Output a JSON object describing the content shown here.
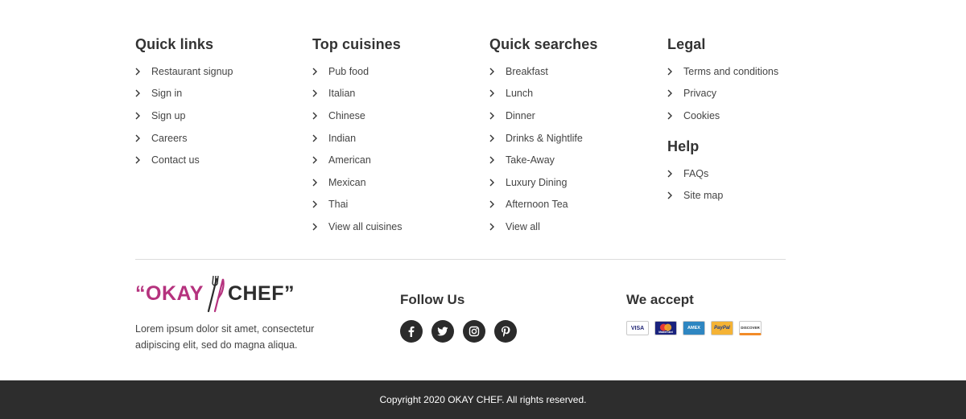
{
  "columns": {
    "quick_links": {
      "title": "Quick links",
      "items": [
        "Restaurant signup",
        "Sign in",
        "Sign up",
        "Careers",
        "Contact us"
      ]
    },
    "top_cuisines": {
      "title": "Top cuisines",
      "items": [
        "Pub food",
        "Italian",
        "Chinese",
        "Indian",
        "American",
        "Mexican",
        "Thai",
        "View all cuisines"
      ]
    },
    "quick_searches": {
      "title": "Quick searches",
      "items": [
        "Breakfast",
        "Lunch",
        "Dinner",
        "Drinks & Nightlife",
        "Take-Away",
        "Luxury Dining",
        "Afternoon Tea",
        "View all"
      ]
    },
    "legal": {
      "title": "Legal",
      "items": [
        "Terms and conditions",
        "Privacy",
        "Cookies"
      ]
    },
    "help": {
      "title": "Help",
      "items": [
        "FAQs",
        "Site map"
      ]
    }
  },
  "brand": {
    "logo_left": "“OKAY",
    "logo_right": "CHEF”",
    "description": "Lorem ipsum dolor sit amet, consectetur adipiscing elit, sed do  magna aliqua.",
    "brand_color": "#b5327e"
  },
  "follow": {
    "title": "Follow Us",
    "icons": [
      "facebook-icon",
      "twitter-icon",
      "instagram-icon",
      "pinterest-icon"
    ]
  },
  "accept": {
    "title": "We accept",
    "cards": [
      {
        "label": "VISA",
        "icon": "visa-card-icon"
      },
      {
        "label": "MasterCard",
        "icon": "mastercard-icon"
      },
      {
        "label": "AMEX",
        "icon": "amex-card-icon"
      },
      {
        "label": "PayPal",
        "icon": "paypal-icon"
      },
      {
        "label": "DISCOVER",
        "icon": "discover-card-icon"
      }
    ]
  },
  "footer": {
    "copyright": "Copyright 2020 OKAY CHEF. All rights reserved.",
    "bar_color": "#2d2d2d"
  }
}
